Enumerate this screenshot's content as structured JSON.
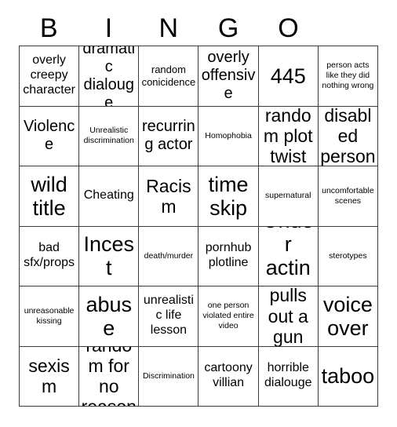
{
  "card": {
    "title": "BINGO",
    "header_letters": [
      "B",
      "I",
      "N",
      "G",
      "O",
      ""
    ],
    "columns": 6,
    "rows": 6,
    "border_color": "#3a3a3a",
    "background_color": "#ffffff",
    "text_color": "#000000"
  },
  "cells": [
    {
      "text": "overly creepy character",
      "size": "md"
    },
    {
      "text": "dramatic dialouge",
      "size": "lg"
    },
    {
      "text": "random conicidence",
      "size": "sm"
    },
    {
      "text": "overly offensive",
      "size": "lg"
    },
    {
      "text": "445",
      "size": "xxl"
    },
    {
      "text": "person acts like they did nothing wrong",
      "size": "xs"
    },
    {
      "text": "Violence",
      "size": "lg"
    },
    {
      "text": "Unrealistic discrimination",
      "size": "xs"
    },
    {
      "text": "recurring actor",
      "size": "lg"
    },
    {
      "text": "Homophobia",
      "size": "xs"
    },
    {
      "text": "random plot twist",
      "size": "xl"
    },
    {
      "text": "disabled person",
      "size": "xl"
    },
    {
      "text": "wild title",
      "size": "xxl"
    },
    {
      "text": "Cheating",
      "size": "md"
    },
    {
      "text": "Racism",
      "size": "xl"
    },
    {
      "text": "time skip",
      "size": "xxl"
    },
    {
      "text": "supernatural",
      "size": "xs"
    },
    {
      "text": "uncomfortable scenes",
      "size": "xs"
    },
    {
      "text": "bad sfx/props",
      "size": "md"
    },
    {
      "text": "Incest",
      "size": "xxl"
    },
    {
      "text": "death/murder",
      "size": "xs"
    },
    {
      "text": "pornhub plotline",
      "size": "md"
    },
    {
      "text": "Under acting",
      "size": "xxl"
    },
    {
      "text": "sterotypes",
      "size": "xs"
    },
    {
      "text": "unreasonable kissing",
      "size": "xs"
    },
    {
      "text": "abuse",
      "size": "xxl"
    },
    {
      "text": "unrealistic life lesson",
      "size": "md"
    },
    {
      "text": "one person violated entire video",
      "size": "xs"
    },
    {
      "text": "pulls out a gun",
      "size": "xl"
    },
    {
      "text": "voice over",
      "size": "xxl"
    },
    {
      "text": "sexism",
      "size": "xl"
    },
    {
      "text": "random for no reason",
      "size": "xl"
    },
    {
      "text": "Discrimination",
      "size": "xs"
    },
    {
      "text": "cartoony villian",
      "size": "md"
    },
    {
      "text": "horrible dialouge",
      "size": "md"
    },
    {
      "text": "taboo",
      "size": "xxl"
    }
  ]
}
